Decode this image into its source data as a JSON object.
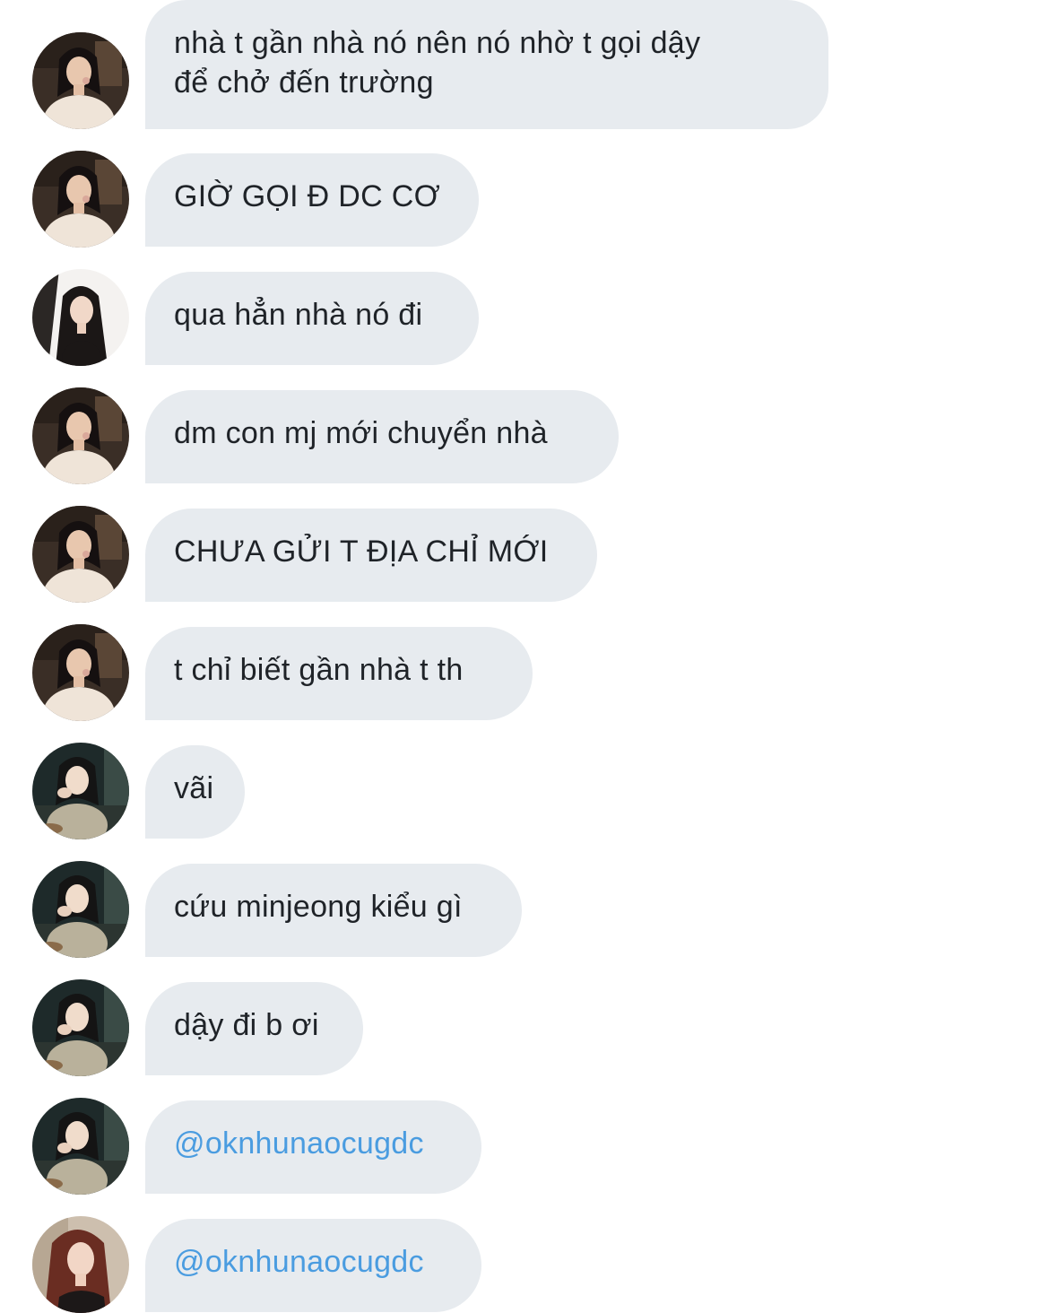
{
  "colors": {
    "bubble_bg": "#e7ebef",
    "text": "#1f2328",
    "mention": "#4a9ce0",
    "background": "#ffffff"
  },
  "messages": [
    {
      "sender": "friend-a",
      "avatar": "avatar-a-photo",
      "text": "nhà t gần nhà nó nên nó nhờ t gọi dậy\nđể chở đến trường"
    },
    {
      "sender": "friend-a",
      "avatar": "avatar-a-photo",
      "text": "GIỜ GỌI Đ DC CƠ"
    },
    {
      "sender": "friend-b",
      "avatar": "avatar-b-photo",
      "text": "qua hẳn nhà nó đi"
    },
    {
      "sender": "friend-a",
      "avatar": "avatar-a-photo",
      "text": "dm con mj mới chuyển nhà"
    },
    {
      "sender": "friend-a",
      "avatar": "avatar-a-photo",
      "text": "CHƯA GỬI T ĐỊA CHỈ MỚI"
    },
    {
      "sender": "friend-a",
      "avatar": "avatar-a-photo",
      "text": "t chỉ biết gần nhà t th"
    },
    {
      "sender": "friend-c",
      "avatar": "avatar-c-photo",
      "text": "vãi"
    },
    {
      "sender": "friend-c",
      "avatar": "avatar-c-photo",
      "text": "cứu minjeong kiểu gì"
    },
    {
      "sender": "friend-c",
      "avatar": "avatar-c-photo",
      "text": "dậy đi b ơi"
    },
    {
      "sender": "friend-c",
      "avatar": "avatar-c-photo",
      "text": "@oknhunaocugdc"
    },
    {
      "sender": "friend-d",
      "avatar": "avatar-d-photo",
      "text": "@oknhunaocugdc"
    }
  ]
}
